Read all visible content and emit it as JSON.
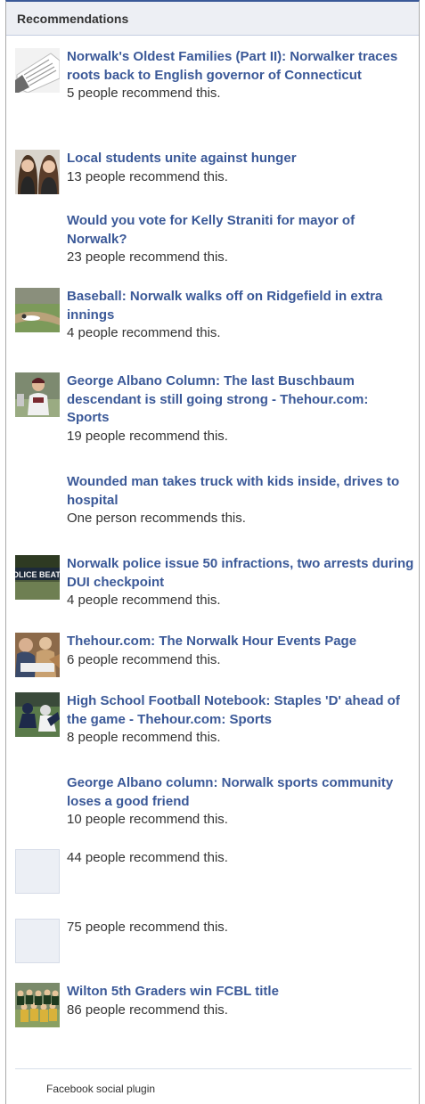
{
  "header": {
    "title": "Recommendations"
  },
  "items": [
    {
      "title": "Norwalk's Oldest Families (Part II): Norwalker traces roots back to English governor of Connecticut",
      "count": "5 people recommend this.",
      "thumb": "newspaper-photo-icon"
    },
    {
      "title": "Local students unite against hunger",
      "count": "13 people recommend this.",
      "thumb": "two-girls-photo-icon"
    },
    {
      "title": "Would you vote for Kelly Straniti for mayor of Norwalk?",
      "count": "23 people recommend this.",
      "thumb": ""
    },
    {
      "title": "Baseball: Norwalk walks off on Ridgefield in extra innings",
      "count": "4 people recommend this.",
      "thumb": "baseball-field-photo-icon"
    },
    {
      "title": "George Albano Column: The last Buschbaum descendant is still going strong - Thehour.com: Sports",
      "count": "19 people recommend this.",
      "thumb": "baseball-player-photo-icon"
    },
    {
      "title": "Wounded man takes truck with kids inside, drives to hospital",
      "count": "One person recommends this.",
      "thumb": ""
    },
    {
      "title": "Norwalk police issue 50 infractions, two arrests during DUI checkpoint",
      "count": "4 people recommend this.",
      "thumb": "police-beat-photo-icon",
      "thumb_text": "OLICE BEAT"
    },
    {
      "title": "Thehour.com: The Norwalk Hour Events Page",
      "count": "6 people recommend this.",
      "thumb": "events-crowd-photo-icon"
    },
    {
      "title": "High School Football Notebook: Staples 'D' ahead of the game - Thehour.com: Sports",
      "count": "8 people recommend this.",
      "thumb": "football-game-photo-icon"
    },
    {
      "title": "George Albano column: Norwalk sports community loses a good friend",
      "count": "10 people recommend this.",
      "thumb": ""
    },
    {
      "title": "",
      "count": "44 people recommend this.",
      "thumb": "placeholder-thumbnail"
    },
    {
      "title": "",
      "count": "75 people recommend this.",
      "thumb": "placeholder-thumbnail"
    },
    {
      "title": "Wilton 5th Graders win FCBL title",
      "count": "86 people recommend this.",
      "thumb": "team-photo-icon"
    }
  ],
  "footer": {
    "label": "Facebook social plugin"
  }
}
